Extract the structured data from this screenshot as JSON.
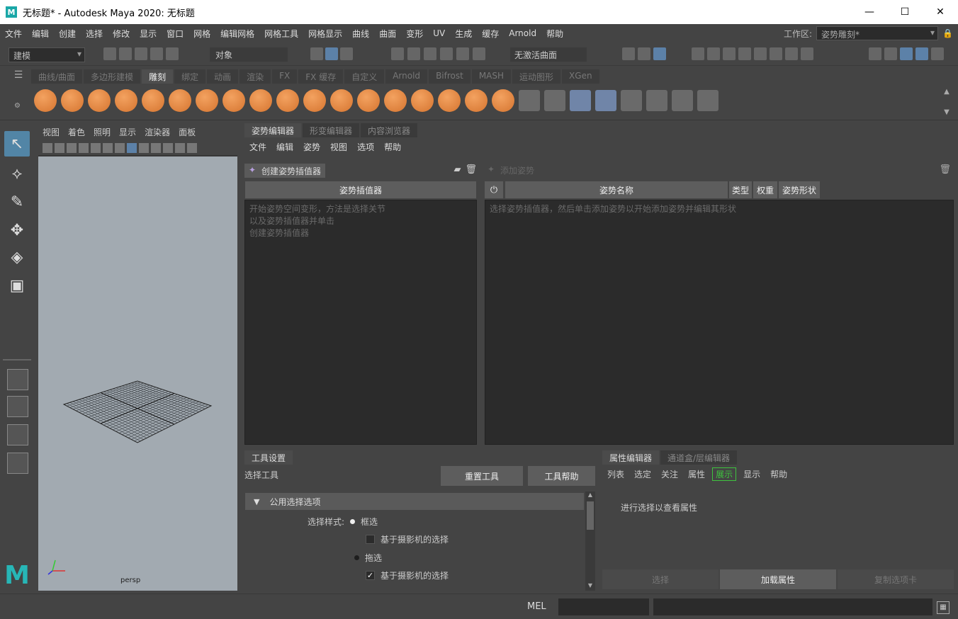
{
  "window": {
    "app_icon_letter": "M",
    "title": "无标题* - Autodesk Maya 2020: 无标题",
    "controls": [
      "—",
      "☐",
      "✕"
    ]
  },
  "menubar": {
    "items": [
      "文件",
      "编辑",
      "创建",
      "选择",
      "修改",
      "显示",
      "窗口",
      "网格",
      "编辑网格",
      "网格工具",
      "网格显示",
      "曲线",
      "曲面",
      "变形",
      "UV",
      "生成",
      "缓存",
      "Arnold",
      "帮助"
    ],
    "workspace_label": "工作区:",
    "workspace_value": "姿势雕刻*"
  },
  "statusline": {
    "mode": "建模",
    "object_field": "对象",
    "surface_field": "无激活曲面"
  },
  "shelf": {
    "tabs": [
      "曲线/曲面",
      "多边形建模",
      "雕刻",
      "绑定",
      "动画",
      "渲染",
      "FX",
      "FX 缓存",
      "自定义",
      "Arnold",
      "Bifrost",
      "MASH",
      "运动图形",
      "XGen"
    ],
    "active_tab": "雕刻"
  },
  "viewport": {
    "menu": [
      "视图",
      "着色",
      "照明",
      "显示",
      "渲染器",
      "面板"
    ],
    "camera_label": "persp"
  },
  "pose_editor": {
    "tabs": [
      "姿势编辑器",
      "形变编辑器",
      "内容浏览器"
    ],
    "active_tab": "姿势编辑器",
    "menu": [
      "文件",
      "编辑",
      "姿势",
      "视图",
      "选项",
      "帮助"
    ],
    "create_button": "创建姿势插值器",
    "left_header": "姿势插值器",
    "left_hint": [
      "开始姿势空间变形，方法是选择关节",
      "以及姿势插值器并单击",
      "创建姿势插值器"
    ],
    "add_pose_button": "添加姿势",
    "columns": [
      "姿势名称",
      "类型",
      "权重",
      "姿势形状"
    ],
    "right_hint": "选择姿势插值器，然后单击添加姿势以开始添加姿势并编辑其形状"
  },
  "tool_settings": {
    "tab": "工具设置",
    "tool_name": "选择工具",
    "reset_button": "重置工具",
    "help_button": "工具帮助",
    "section_title": "公用选择选项",
    "style_label": "选择样式:",
    "marquee": "框选",
    "camera_based_1": "基于摄影机的选择",
    "drag": "拖选",
    "camera_based_2": "基于摄影机的选择"
  },
  "attribute_editor": {
    "tabs": [
      "属性编辑器",
      "通道盒/层编辑器"
    ],
    "active_tab": "属性编辑器",
    "menu": [
      "列表",
      "选定",
      "关注",
      "属性",
      "展示",
      "显示",
      "帮助"
    ],
    "highlighted_menu": "展示",
    "message": "进行选择以查看属性",
    "buttons": [
      "选择",
      "加载属性",
      "复制选项卡"
    ],
    "active_button": "加载属性"
  },
  "commandline": {
    "label": "MEL"
  }
}
